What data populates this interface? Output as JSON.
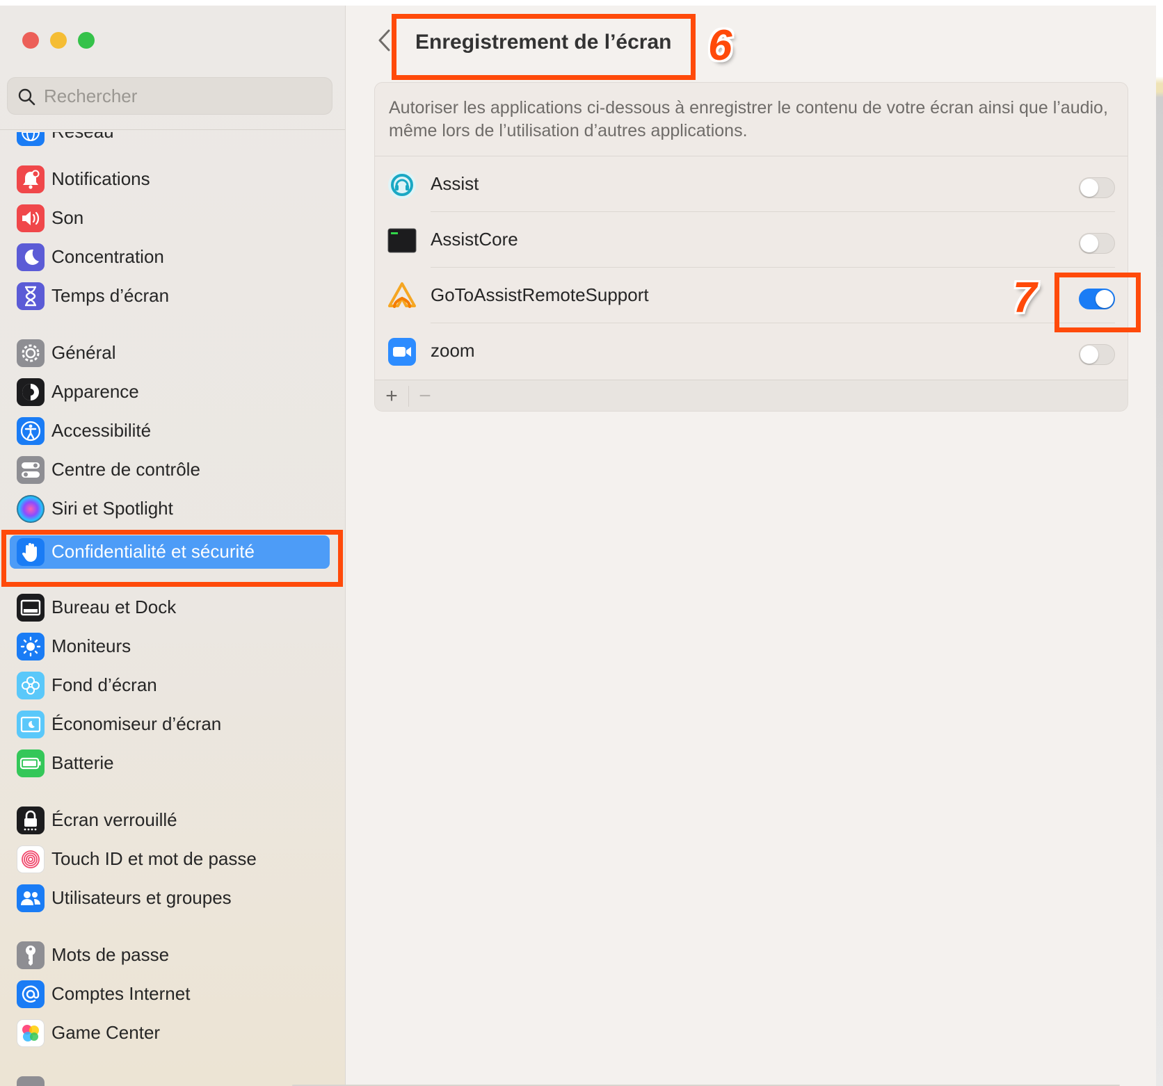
{
  "window": {
    "traffic_lights": [
      "close",
      "minimize",
      "zoom"
    ]
  },
  "search": {
    "placeholder": "Rechercher"
  },
  "sidebar": {
    "partial_item": "Réseau",
    "items": [
      {
        "label": "Notifications",
        "icon": "bell-icon",
        "color": "#f0474a"
      },
      {
        "label": "Son",
        "icon": "speaker-icon",
        "color": "#f0474a"
      },
      {
        "label": "Concentration",
        "icon": "moon-icon",
        "color": "#5b5bd6"
      },
      {
        "label": "Temps d’écran",
        "icon": "hourglass-icon",
        "color": "#5b5bd6"
      },
      {
        "label": "Général",
        "icon": "gear-icon",
        "color": "#8e8e93"
      },
      {
        "label": "Apparence",
        "icon": "appearance-icon",
        "color": "#1c1c1e"
      },
      {
        "label": "Accessibilité",
        "icon": "accessibility-icon",
        "color": "#1a7cf5"
      },
      {
        "label": "Centre de contrôle",
        "icon": "control-center-icon",
        "color": "#8e8e93"
      },
      {
        "label": "Siri et Spotlight",
        "icon": "siri-icon",
        "color": "#2c2c3a"
      },
      {
        "label": "Confidentialité et sécurité",
        "icon": "hand-icon",
        "color": "#1a7cf5",
        "selected": true
      },
      {
        "label": "Bureau et Dock",
        "icon": "dock-icon",
        "color": "#1c1c1e"
      },
      {
        "label": "Moniteurs",
        "icon": "sun-icon",
        "color": "#1a7cf5"
      },
      {
        "label": "Fond d’écran",
        "icon": "flower-icon",
        "color": "#5ac8fa"
      },
      {
        "label": "Économiseur d’écran",
        "icon": "screensaver-icon",
        "color": "#5ac8fa"
      },
      {
        "label": "Batterie",
        "icon": "battery-icon",
        "color": "#34c759"
      },
      {
        "label": "Écran verrouillé",
        "icon": "lock-icon",
        "color": "#1c1c1e"
      },
      {
        "label": "Touch ID et mot de passe",
        "icon": "fingerprint-icon",
        "color": "#ffffff"
      },
      {
        "label": "Utilisateurs et groupes",
        "icon": "users-icon",
        "color": "#1a7cf5"
      },
      {
        "label": "Mots de passe",
        "icon": "key-icon",
        "color": "#8e8e93"
      },
      {
        "label": "Comptes Internet",
        "icon": "at-icon",
        "color": "#1a7cf5"
      },
      {
        "label": "Game Center",
        "icon": "game-center-icon",
        "color": "#ffffff"
      }
    ]
  },
  "main": {
    "title": "Enregistrement de l’écran",
    "description": "Autoriser les applications ci-dessous à enregistrer le contenu de votre écran ainsi que l’audio, même lors de l’utilisation d’autres applications.",
    "apps": [
      {
        "name": "Assist",
        "icon": "assist-icon",
        "enabled": false
      },
      {
        "name": "AssistCore",
        "icon": "terminal-exec-icon",
        "enabled": false
      },
      {
        "name": "GoToAssistRemoteSupport",
        "icon": "gotoassist-icon",
        "enabled": true
      },
      {
        "name": "zoom",
        "icon": "zoom-camera-icon",
        "enabled": false
      }
    ],
    "footer": {
      "add": "+",
      "remove": "−"
    }
  },
  "annotations": {
    "step_title": "6",
    "step_toggle": "7",
    "highlight_color": "#ff4a0a"
  },
  "colors": {
    "accent": "#1a7cf5",
    "selection": "#4d9cf7"
  }
}
